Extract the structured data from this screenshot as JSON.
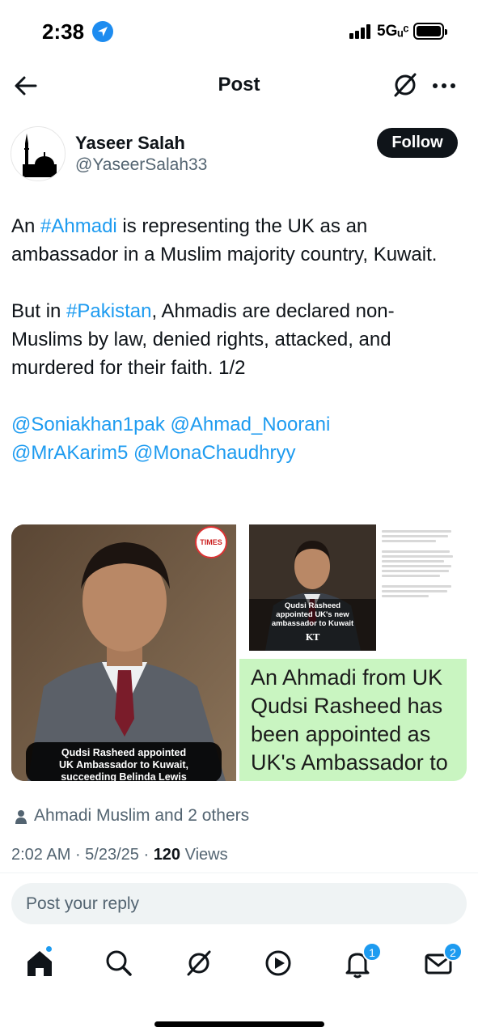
{
  "status_bar": {
    "time": "2:38",
    "network": "5Gᵤᶜ"
  },
  "header": {
    "title": "Post",
    "icons": [
      "back-arrow-icon",
      "grok-icon",
      "more-dots-icon"
    ]
  },
  "author": {
    "name": "Yaseer Salah",
    "handle": "@YaseerSalah33",
    "follow_label": "Follow"
  },
  "tweet": {
    "p1_prefix": "An ",
    "p1_hashtag": "#Ahmadi",
    "p1_suffix": " is representing the UK as an ambassador in a Muslim majority country, Kuwait.",
    "p2_prefix": "But in ",
    "p2_hashtag": "#Pakistan",
    "p2_suffix": ", Ahmadis are declared non-Muslims by law, denied rights, attacked, and murdered for their faith. 1/2",
    "mentions": [
      "@Soniakhan1pak",
      "@Ahmad_Noorani",
      "@MrAKarim5",
      "@MonaChaudhryy"
    ]
  },
  "media": {
    "left_logo": "TIMES",
    "left_caption_l1": "Qudsi Rasheed appointed",
    "left_caption_l2": "UK Ambassador to Kuwait,",
    "left_caption_l3": "succeeding Belinda Lewis",
    "inner_caption_l1": "Qudsi Rasheed",
    "inner_caption_l2": "appointed UK's new",
    "inner_caption_l3": "ambassador to Kuwait",
    "inner_logo": "KT",
    "green_text": "An Ahmadi from UK Qudsi Rasheed has been appointed as UK's Ambassador to Kuwait. All muslim"
  },
  "liked_by": "Ahmadi Muslim and 2 others",
  "meta": {
    "time": "2:02 AM",
    "sep1": " · ",
    "date": "5/23/25",
    "sep2": " · ",
    "views_count": "120",
    "views_label": " Views"
  },
  "reply": {
    "placeholder": "Post your reply"
  },
  "bottom_nav": {
    "items": [
      "home-icon",
      "search-icon",
      "grok-icon",
      "video-icon",
      "notifications-icon",
      "messages-icon"
    ],
    "notifications_badge": "1",
    "messages_badge": "2"
  },
  "colors": {
    "accent": "#1d9bf0",
    "text": "#0f1419",
    "secondary": "#536471",
    "green_highlight": "#c9f5c1"
  }
}
